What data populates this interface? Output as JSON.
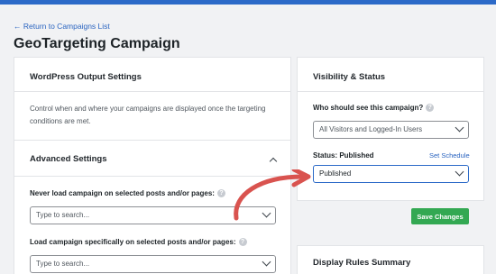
{
  "back_link": "← Return to Campaigns List",
  "page_title": "GeoTargeting Campaign",
  "left_panel": {
    "output_heading": "WordPress Output Settings",
    "output_description": "Control when and where your campaigns are displayed once the targeting conditions are met.",
    "advanced_heading": "Advanced Settings",
    "never_load_label": "Never load campaign on selected posts and/or pages:",
    "never_load_placeholder": "Type to search...",
    "load_specifically_label": "Load campaign specifically on selected posts and/or pages:",
    "load_specifically_placeholder": "Type to search..."
  },
  "right_panel": {
    "visibility_heading": "Visibility & Status",
    "who_label": "Who should see this campaign?",
    "who_value": "All Visitors and Logged-In Users",
    "status_label": "Status: Published",
    "set_schedule": "Set Schedule",
    "status_value": "Published",
    "save_button": "Save Changes",
    "rules_heading": "Display Rules Summary"
  },
  "colors": {
    "accent": "#2c6ac8",
    "save": "#33a852",
    "arrow": "#d9534f"
  }
}
